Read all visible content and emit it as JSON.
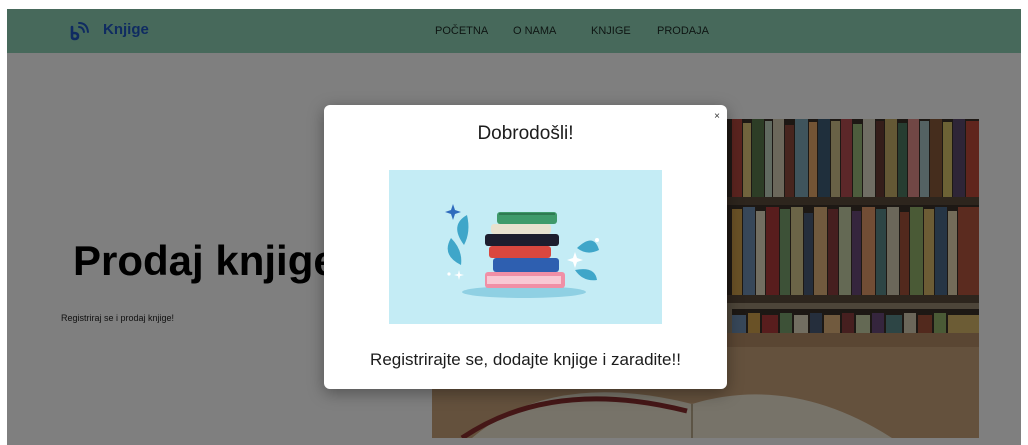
{
  "navbar": {
    "brand": "Knjige",
    "links": [
      "POČETNA",
      "O NAMA",
      "KNJIGE",
      "PRODAJA"
    ],
    "brand_icon": "wifi-signal-icon",
    "background": "#8fd3b6",
    "brand_color": "#1f57c3"
  },
  "hero": {
    "title": "Prodaj knjige",
    "subtitle": "Registriraj se i prodaj knjige!"
  },
  "modal": {
    "title": "Dobrodošli!",
    "close": "×",
    "message": "Registrirajte se, dodajte knjige i zaradite!!",
    "illustration_bg": "#c4ecf5"
  }
}
